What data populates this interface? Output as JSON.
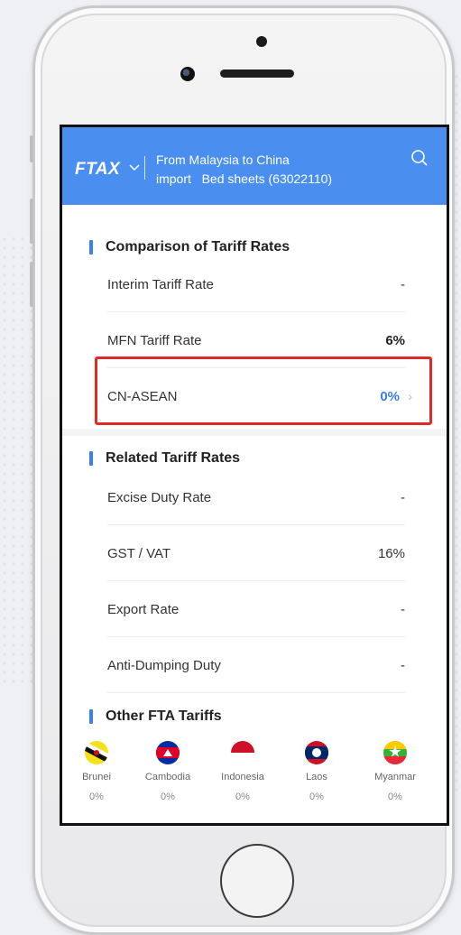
{
  "header": {
    "logo": "FTAX",
    "route": "From Malaysia to China",
    "product": "import   Bed sheets (63022110)"
  },
  "comparison": {
    "title": "Comparison of Tariff Rates",
    "rows": [
      {
        "label": "Interim Tariff Rate",
        "value": "-"
      },
      {
        "label": "MFN Tariff Rate",
        "value": "6%"
      },
      {
        "label": "CN-ASEAN",
        "value": "0%"
      }
    ]
  },
  "related": {
    "title": "Related Tariff Rates",
    "rows": [
      {
        "label": "Excise Duty Rate",
        "value": "-"
      },
      {
        "label": "GST / VAT",
        "value": "16%"
      },
      {
        "label": "Export Rate",
        "value": "-"
      },
      {
        "label": "Anti-Dumping Duty",
        "value": "-"
      }
    ]
  },
  "other_fta": {
    "title": "Other FTA Tariffs",
    "countries": [
      {
        "name": "Brunei",
        "value": "0%",
        "icon": "brunei-flag-icon"
      },
      {
        "name": "Cambodia",
        "value": "0%",
        "icon": "cambodia-flag-icon"
      },
      {
        "name": "Indonesia",
        "value": "0%",
        "icon": "indonesia-flag-icon"
      },
      {
        "name": "Laos",
        "value": "0%",
        "icon": "laos-flag-icon"
      },
      {
        "name": "Myanmar",
        "value": "0%",
        "icon": "myanmar-flag-icon"
      }
    ]
  },
  "colors": {
    "header_bg": "#4a8ff0",
    "accent": "#3a7ef0",
    "highlight_border": "#e02a2a"
  }
}
